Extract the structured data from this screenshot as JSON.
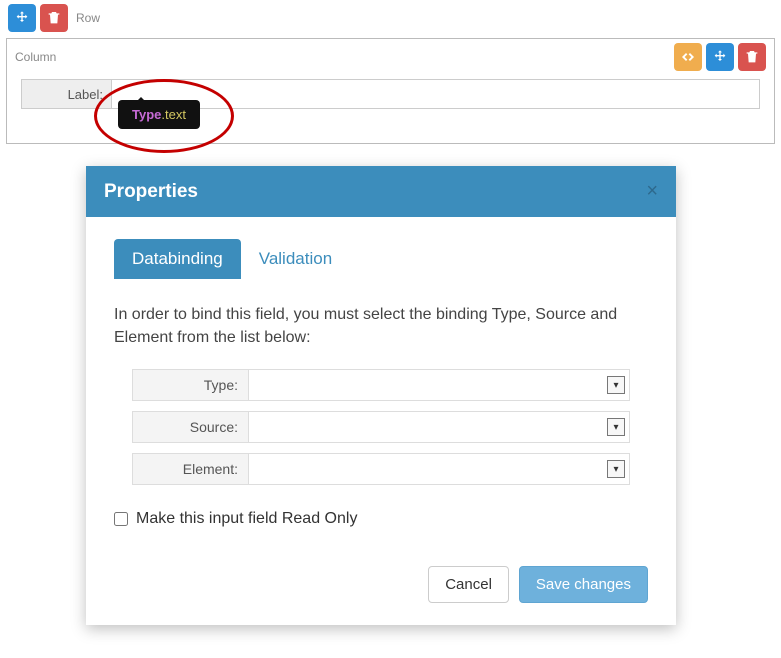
{
  "row": {
    "label": "Row"
  },
  "column": {
    "label": "Column"
  },
  "field": {
    "label": "Label:",
    "value": ""
  },
  "tooltip": {
    "type_text": "Type",
    "suffix_text": ".text"
  },
  "modal": {
    "title": "Properties",
    "tabs": {
      "databinding": "Databinding",
      "validation": "Validation"
    },
    "instruction": "In order to bind this field, you must select the binding Type, Source and Element from the list below:",
    "bind_labels": {
      "type": "Type:",
      "source": "Source:",
      "element": "Element:"
    },
    "bind_values": {
      "type": "",
      "source": "",
      "element": ""
    },
    "readonly_label": "Make this input field Read Only",
    "readonly_checked": false,
    "buttons": {
      "cancel": "Cancel",
      "save": "Save changes"
    }
  }
}
